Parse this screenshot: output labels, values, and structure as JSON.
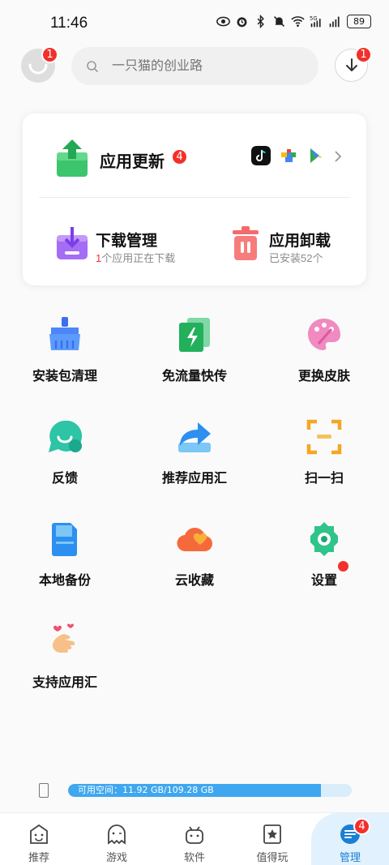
{
  "status_bar": {
    "time": "11:46",
    "icons": [
      "eye-icon",
      "alarm-icon",
      "bluetooth-icon",
      "mute-icon",
      "wifi-icon",
      "signal-5g-icon",
      "signal-icon"
    ],
    "battery": "89"
  },
  "header": {
    "avatar_badge": "1",
    "search_placeholder": "一只猫的创业路",
    "download_badge": "1"
  },
  "card": {
    "update": {
      "label": "应用更新",
      "badge": "4",
      "apps": [
        "tiktok-app-icon",
        "play-services-app-icon",
        "play-store-app-icon"
      ]
    },
    "download_manager": {
      "label": "下载管理",
      "sub_count": "1",
      "sub_text": "个应用正在下载"
    },
    "uninstall": {
      "label": "应用卸载",
      "sub_text": "已安装52个"
    }
  },
  "grid": [
    {
      "label": "安装包清理",
      "icon": "broom-icon"
    },
    {
      "label": "免流量快传",
      "icon": "transfer-icon"
    },
    {
      "label": "更换皮肤",
      "icon": "palette-icon"
    },
    {
      "label": "反馈",
      "icon": "feedback-icon"
    },
    {
      "label": "推荐应用汇",
      "icon": "share-icon"
    },
    {
      "label": "扫一扫",
      "icon": "scan-icon"
    },
    {
      "label": "本地备份",
      "icon": "sdcard-icon"
    },
    {
      "label": "云收藏",
      "icon": "cloud-heart-icon"
    },
    {
      "label": "设置",
      "icon": "gear-icon",
      "dot": true
    },
    {
      "label": "支持应用汇",
      "icon": "finger-heart-icon"
    }
  ],
  "storage": {
    "text": "可用空间：11.92 GB/109.28 GB",
    "used_fraction": 0.89
  },
  "bottom_nav": [
    {
      "label": "推荐",
      "icon": "recommend-icon"
    },
    {
      "label": "游戏",
      "icon": "game-ghost-icon"
    },
    {
      "label": "软件",
      "icon": "android-icon"
    },
    {
      "label": "值得玩",
      "icon": "star-bookmark-icon"
    },
    {
      "label": "管理",
      "icon": "manage-icon",
      "badge": "4",
      "active": true
    }
  ],
  "colors": {
    "accent": "#3ea7ef",
    "badge": "#f2302b",
    "active_tab_bg": "#e1f1fd"
  }
}
